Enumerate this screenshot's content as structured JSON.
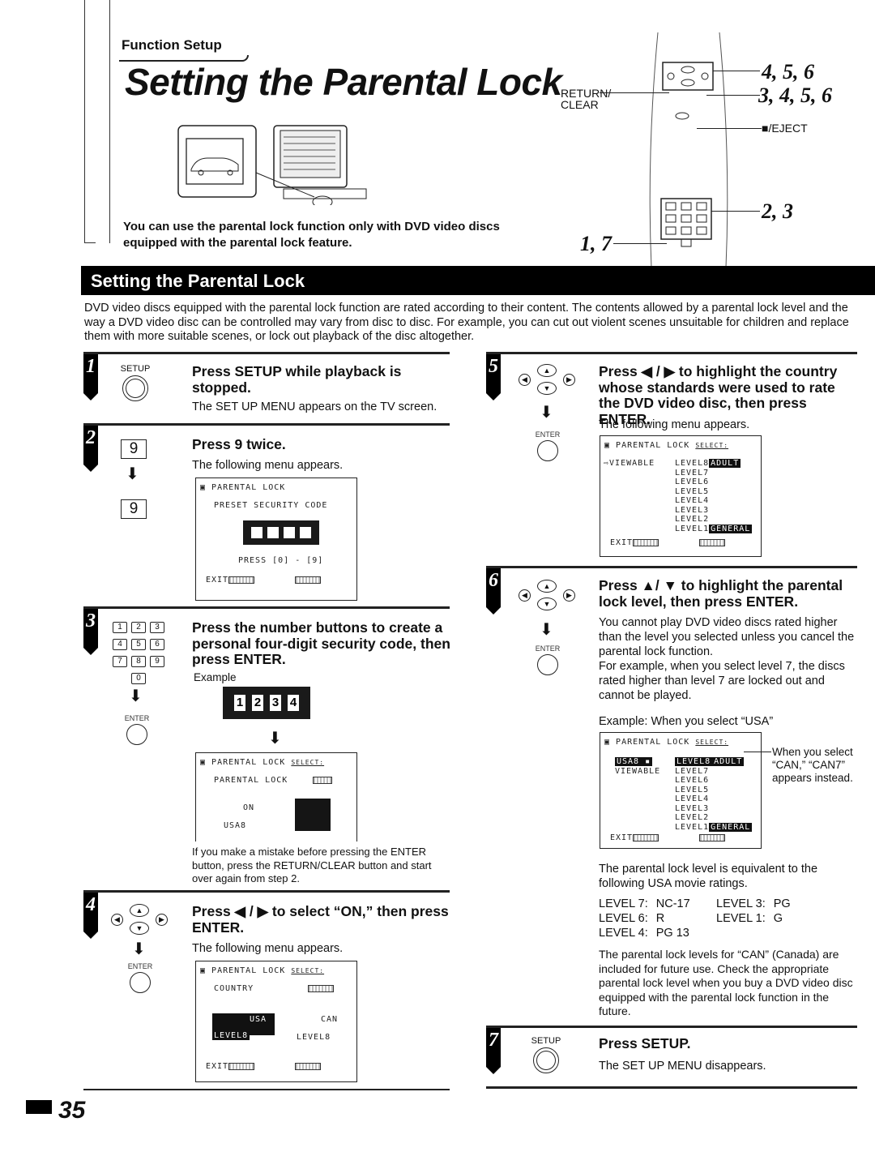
{
  "header": {
    "section_label": "Function Setup",
    "title": "Setting the Parental Lock",
    "intro_note": "You can use the parental lock function only with DVD video discs equipped with the parental lock feature."
  },
  "remote": {
    "return_clear_label": "RETURN/ CLEAR",
    "stop_eject_label": "■/EJECT",
    "callouts": {
      "dpad": "4, 5, 6",
      "enter": "3, 4, 5, 6",
      "numpad": "2, 3",
      "setup": "1, 7"
    }
  },
  "band_title": "Setting the Parental Lock",
  "intro": "DVD video discs equipped with the parental lock function are rated according to their content. The contents allowed by a parental lock level and the way a DVD video disc can be controlled may vary from disc to disc. For example, you can cut out violent scenes unsuitable for children and replace them with more suitable scenes, or lock out playback of the disc altogether.",
  "buttons": {
    "setup": "SETUP",
    "enter": "ENTER",
    "nine": "9",
    "numpad": [
      "1",
      "2",
      "3",
      "4",
      "5",
      "6",
      "7",
      "8",
      "9",
      "0"
    ],
    "up": "▲",
    "down": "▼",
    "left": "◀",
    "right": "▶",
    "arrow": "⬇"
  },
  "steps": [
    {
      "num": "1",
      "title": "Press SETUP while playback is stopped.",
      "body": "The SET UP MENU appears on the TV screen."
    },
    {
      "num": "2",
      "title": "Press 9 twice.",
      "body": "The following menu appears."
    },
    {
      "num": "3",
      "title": "Press the number buttons to create a personal four-digit security code, then press ENTER.",
      "body": "Example",
      "note": "If you make a mistake before pressing the ENTER button, press the RETURN/CLEAR button and start over again from step 2."
    },
    {
      "num": "4",
      "title": "Press ◀ / ▶ to select “ON,” then press ENTER.",
      "body": "The following menu appears."
    },
    {
      "num": "5",
      "title": "Press ◀ / ▶ to highlight the country whose standards were used to rate the DVD video disc, then press ENTER.",
      "body": "The following menu appears."
    },
    {
      "num": "6",
      "title": "Press ▲/ ▼ to highlight the parental lock level, then press ENTER.",
      "body": "You cannot play DVD video discs rated higher than the level you selected unless you cancel the parental lock function.\nFor example, when you select level 7, the discs rated higher than level 7 are locked out and cannot be played.",
      "example_label": "Example: When you select “USA”",
      "callout": "When you select “CAN,” “CAN7” appears instead.",
      "ratings_intro": "The parental lock level is equivalent to the following USA movie ratings.",
      "canada_note": "The parental lock levels for “CAN” (Canada) are included for future use. Check the appropriate parental lock level when you buy a DVD video disc equipped with the parental lock function in the future."
    },
    {
      "num": "7",
      "title": "Press SETUP.",
      "body": "The SET UP MENU disappears."
    }
  ],
  "osd": {
    "title": "PARENTAL LOCK",
    "select": "SELECT:",
    "preset_code": "PRESET SECURITY CODE",
    "press_range": "PRESS [0] - [9]",
    "exit": "EXIT",
    "parental_lock": "PARENTAL LOCK",
    "on": "ON",
    "usa8": "USA8",
    "country": "COUNTRY",
    "usa": "USA",
    "can": "CAN",
    "level8": "LEVEL8",
    "viewable": "VIEWABLE",
    "levels": [
      "LEVEL8",
      "LEVEL7",
      "LEVEL6",
      "LEVEL5",
      "LEVEL4",
      "LEVEL3",
      "LEVEL2",
      "LEVEL1"
    ],
    "adult": "ADULT",
    "general": "GENERAL",
    "example_code": [
      "1",
      "2",
      "3",
      "4"
    ]
  },
  "ratings": [
    {
      "level": "LEVEL 7:",
      "rating": "NC-17"
    },
    {
      "level": "LEVEL 6:",
      "rating": "R"
    },
    {
      "level": "LEVEL 4:",
      "rating": "PG 13"
    },
    {
      "level": "LEVEL 3:",
      "rating": "PG"
    },
    {
      "level": "LEVEL 1:",
      "rating": "G"
    }
  ],
  "page_number": "35"
}
